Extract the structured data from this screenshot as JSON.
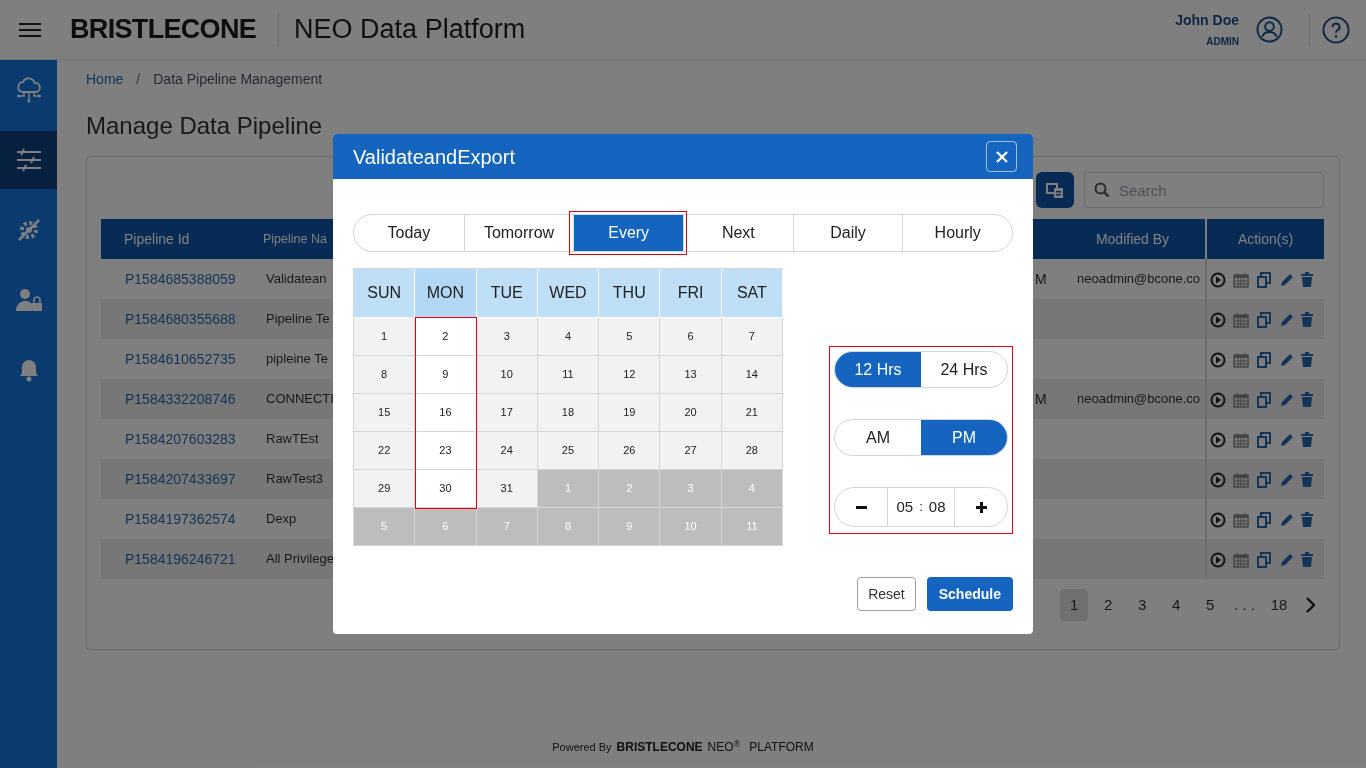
{
  "header": {
    "logo": "BRISTLECONE",
    "app_name": "NEO Data Platform",
    "user": {
      "name": "John Doe",
      "role": "ADMIN"
    }
  },
  "sidebar": {
    "items": [
      {
        "selected": false
      },
      {
        "selected": true
      },
      {
        "selected": false
      },
      {
        "selected": false
      },
      {
        "selected": false
      }
    ]
  },
  "breadcrumb": [
    {
      "label": "Home",
      "kind": "link"
    },
    {
      "label": "/",
      "kind": "separator"
    },
    {
      "label": "Data Pipeline Management",
      "kind": "current"
    }
  ],
  "page_title": "Manage Data Pipeline",
  "search": {
    "placeholder": "Search"
  },
  "table": {
    "columns": {
      "pipeline_id": "Pipeline Id",
      "pipeline_name": "Pipeline Na",
      "modified_by": "Modified By",
      "actions": "Action(s)"
    },
    "rows": [
      {
        "pipeline_id": "P1584685388059",
        "pipeline_name": "Validatean",
        "column_3": "M",
        "modified_by": "neoadmin@bcone.co"
      },
      {
        "pipeline_id": "P1584680355688",
        "pipeline_name": "Pipeline Te"
      },
      {
        "pipeline_id": "P1584610652735",
        "pipeline_name": "pipleine Te"
      },
      {
        "pipeline_id": "P1584332208746",
        "pipeline_name": "CONNECTI",
        "column_3": "M",
        "modified_by": "neoadmin@bcone.co"
      },
      {
        "pipeline_id": "P1584207603283",
        "pipeline_name": "RawTEst"
      },
      {
        "pipeline_id": "P1584207433697",
        "pipeline_name": "RawTest3"
      },
      {
        "pipeline_id": "P1584197362574",
        "pipeline_name": "Dexp"
      },
      {
        "pipeline_id": "P1584196246721",
        "pipeline_name": "All Privilege"
      }
    ]
  },
  "pagination": [
    {
      "label": "1",
      "selected": true
    },
    {
      "label": "2",
      "selected": false
    },
    {
      "label": "3",
      "selected": false
    },
    {
      "label": "4",
      "selected": false
    },
    {
      "label": "5",
      "selected": false
    },
    {
      "label": ". . .",
      "selected": false
    },
    {
      "label": "18",
      "selected": false
    }
  ],
  "dialog": {
    "title": "ValidateandExport",
    "tabs": [
      {
        "label": "Today",
        "selected": false,
        "highlighted": false
      },
      {
        "label": "Tomorrow",
        "selected": false,
        "highlighted": false
      },
      {
        "label": "Every",
        "selected": true,
        "highlighted": true
      },
      {
        "label": "Next",
        "selected": false,
        "highlighted": false
      },
      {
        "label": "Daily",
        "selected": false,
        "highlighted": false
      },
      {
        "label": "Hourly",
        "selected": false,
        "highlighted": false
      }
    ],
    "calendar": {
      "weekdays": [
        {
          "label": "SUN",
          "selected": false
        },
        {
          "label": "MON",
          "selected": true
        },
        {
          "label": "TUE",
          "selected": false
        },
        {
          "label": "WED",
          "selected": false
        },
        {
          "label": "THU",
          "selected": false
        },
        {
          "label": "FRI",
          "selected": false
        },
        {
          "label": "SAT",
          "selected": false
        }
      ],
      "weeks": [
        [
          {
            "day": "1",
            "outside_month": false
          },
          {
            "day": "2",
            "outside_month": false
          },
          {
            "day": "3",
            "outside_month": false
          },
          {
            "day": "4",
            "outside_month": false
          },
          {
            "day": "5",
            "outside_month": false
          },
          {
            "day": "6",
            "outside_month": false
          },
          {
            "day": "7",
            "outside_month": false
          }
        ],
        [
          {
            "day": "8",
            "outside_month": false
          },
          {
            "day": "9",
            "outside_month": false
          },
          {
            "day": "10",
            "outside_month": false
          },
          {
            "day": "11",
            "outside_month": false
          },
          {
            "day": "12",
            "outside_month": false
          },
          {
            "day": "13",
            "outside_month": false
          },
          {
            "day": "14",
            "outside_month": false
          }
        ],
        [
          {
            "day": "15",
            "outside_month": false
          },
          {
            "day": "16",
            "outside_month": false
          },
          {
            "day": "17",
            "outside_month": false
          },
          {
            "day": "18",
            "outside_month": false
          },
          {
            "day": "19",
            "outside_month": false
          },
          {
            "day": "20",
            "outside_month": false
          },
          {
            "day": "21",
            "outside_month": false
          }
        ],
        [
          {
            "day": "22",
            "outside_month": false
          },
          {
            "day": "23",
            "outside_month": false
          },
          {
            "day": "24",
            "outside_month": false
          },
          {
            "day": "25",
            "outside_month": false
          },
          {
            "day": "26",
            "outside_month": false
          },
          {
            "day": "27",
            "outside_month": false
          },
          {
            "day": "28",
            "outside_month": false
          }
        ],
        [
          {
            "day": "29",
            "outside_month": false
          },
          {
            "day": "30",
            "outside_month": false
          },
          {
            "day": "31",
            "outside_month": false
          },
          {
            "day": "1",
            "outside_month": true
          },
          {
            "day": "2",
            "outside_month": true
          },
          {
            "day": "3",
            "outside_month": true
          },
          {
            "day": "4",
            "outside_month": true
          }
        ],
        [
          {
            "day": "5",
            "outside_month": true
          },
          {
            "day": "6",
            "outside_month": true
          },
          {
            "day": "7",
            "outside_month": true
          },
          {
            "day": "8",
            "outside_month": true
          },
          {
            "day": "9",
            "outside_month": true
          },
          {
            "day": "10",
            "outside_month": true
          },
          {
            "day": "11",
            "outside_month": true
          }
        ]
      ]
    },
    "time": {
      "highlighted": true,
      "formats": [
        {
          "label": "12 Hrs",
          "selected": true
        },
        {
          "label": "24 Hrs",
          "selected": false
        }
      ],
      "periods": [
        {
          "label": "AM",
          "selected": false
        },
        {
          "label": "PM",
          "selected": true
        }
      ],
      "hours": "05",
      "separator": ":",
      "minutes": "08"
    },
    "buttons": [
      {
        "label": "Reset",
        "kind": "secondary"
      },
      {
        "label": "Schedule",
        "kind": "primary"
      }
    ]
  },
  "footer": {
    "prefix": "Powered By",
    "brand": "BRISTLECONE",
    "product": "NEO$^{®}$",
    "suffix": "PLATFORM"
  }
}
